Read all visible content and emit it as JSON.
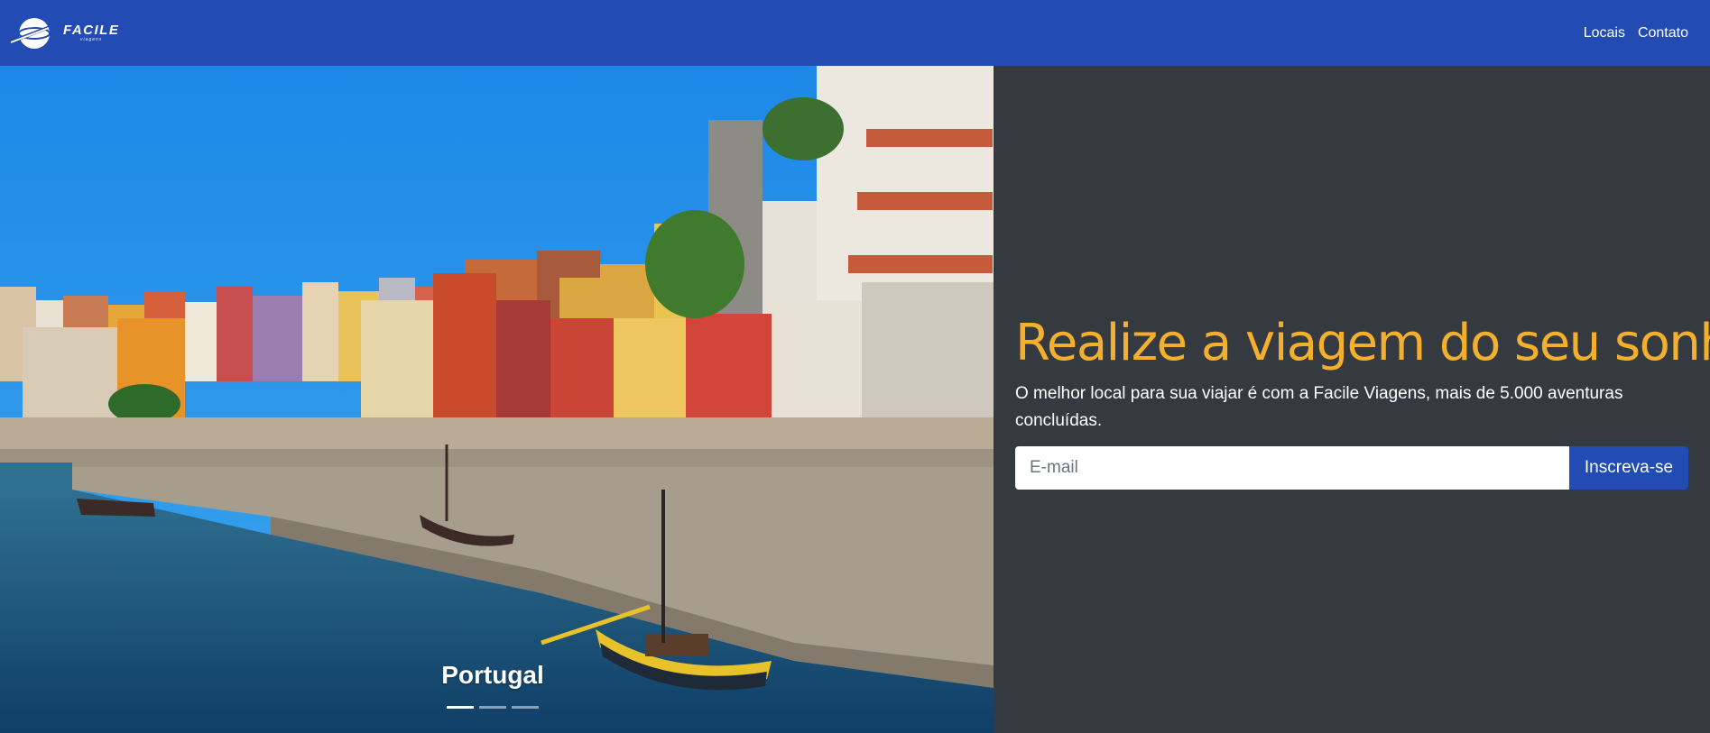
{
  "brand": {
    "name": "FACILE",
    "subtitle": "viagens",
    "logo_icon": "plane-globe-icon"
  },
  "nav": {
    "items": [
      {
        "label": "Locais"
      },
      {
        "label": "Contato"
      }
    ]
  },
  "carousel": {
    "caption": "Portugal",
    "slide_count": 3,
    "active_index": 0
  },
  "hero": {
    "headline": "Realize a viagem do seu sonho",
    "lead": "O melhor local para sua viajar é com a Facile Viagens, mais de 5.000 aventuras concluídas.",
    "email_placeholder": "E-mail",
    "email_value": "",
    "submit_label": "Inscreva-se"
  },
  "colors": {
    "navbar": "#224bb4",
    "accent": "#f4b02d",
    "panel": "#343a40",
    "button": "#224bb4"
  }
}
